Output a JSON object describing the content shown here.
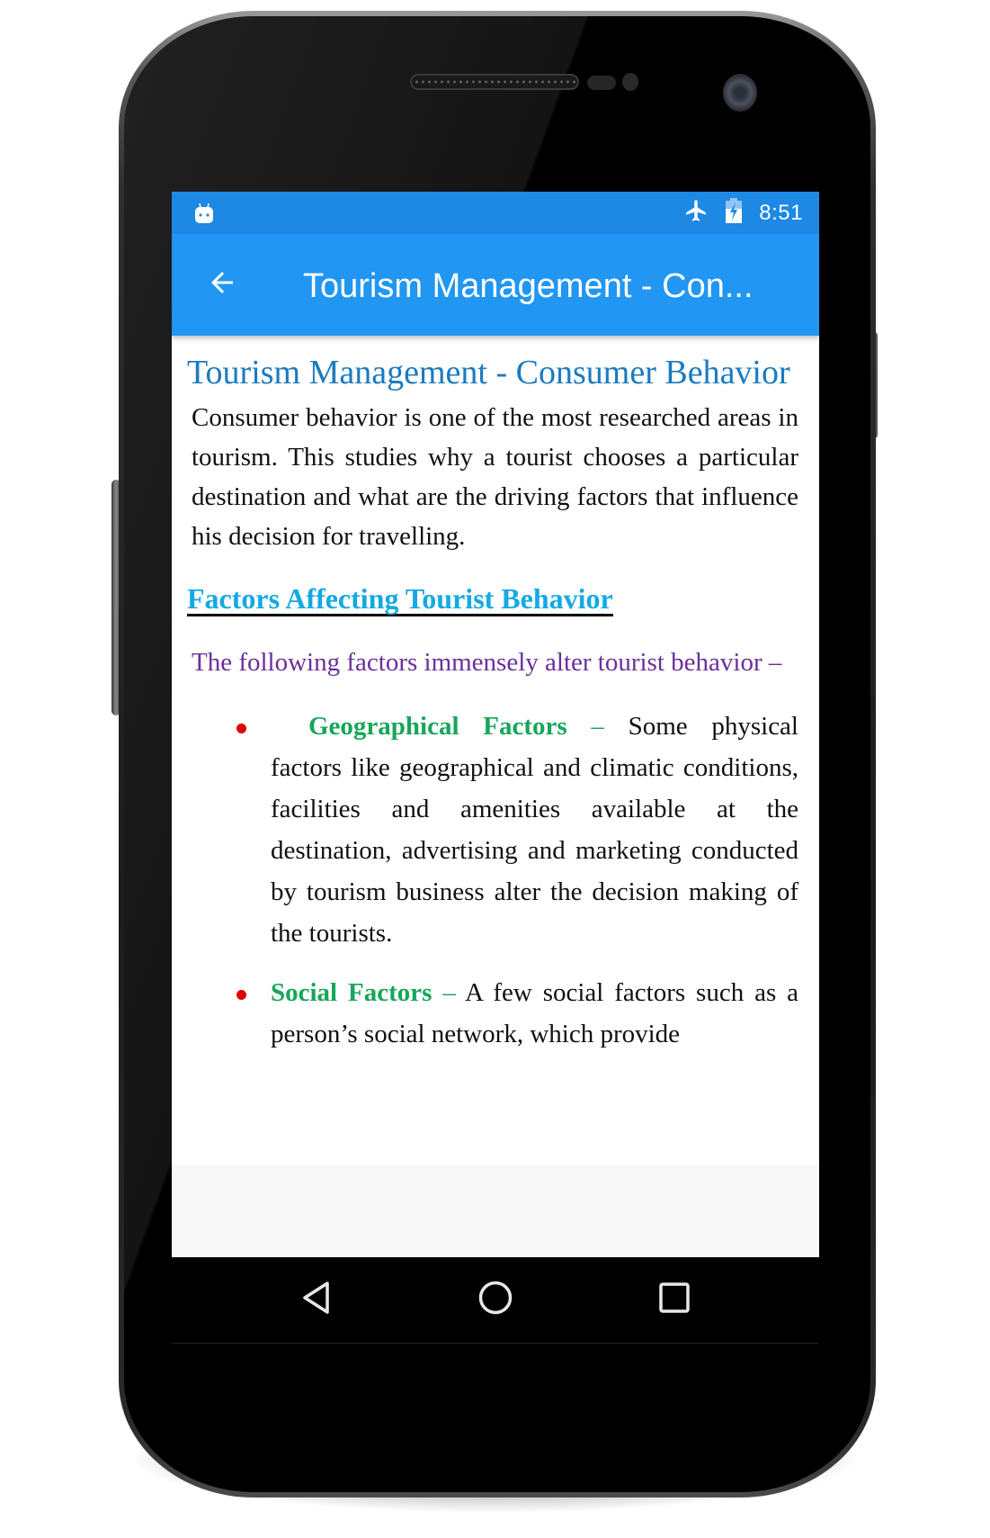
{
  "status_bar": {
    "left_icons": [
      "android-debug-icon"
    ],
    "right_icons": [
      "airplane-mode-icon",
      "battery-charging-icon"
    ],
    "time": "8:51"
  },
  "app_bar": {
    "back_icon": "arrow-left-icon",
    "title": "Tourism Management - Con..."
  },
  "article": {
    "title": "Tourism Management - Consumer Behavior",
    "intro": "Consumer behavior is one of the most researched areas in tourism. This studies why a tourist chooses a particular destination and what are the driving factors that influence his decision for travelling.",
    "section_heading": "Factors Affecting Tourist Behavior",
    "lead": "The following factors immensely alter tourist behavior –",
    "factors": [
      {
        "label": "Geographical Factors",
        "separator": " – ",
        "text": "Some physical factors like geographical and climatic conditions, facilities and amenities available at the destination, advertising and marketing conducted by tourism business alter the decision making of the tourists."
      },
      {
        "label": "Social Factors",
        "separator": " – ",
        "text": "A few social factors such as a person’s social network, which provide"
      }
    ]
  },
  "nav_bar": {
    "buttons": [
      "back",
      "home",
      "recents"
    ]
  },
  "colors": {
    "status_bar": "#1e88e5",
    "app_bar": "#2196f3",
    "article_title": "#1b7bbf",
    "section_heading": "#14a9e3",
    "lead_text": "#6b2f9a",
    "factor_label": "#17a659",
    "bullet": "#e00000"
  }
}
